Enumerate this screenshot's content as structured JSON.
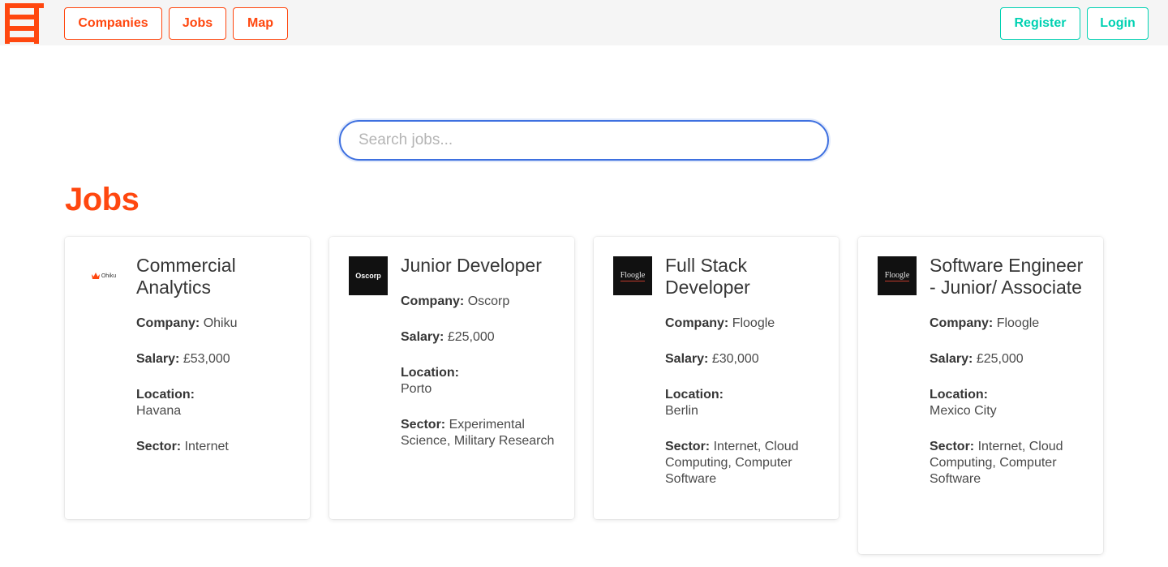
{
  "nav": {
    "links": [
      "Companies",
      "Jobs",
      "Map"
    ],
    "register": "Register",
    "login": "Login"
  },
  "search": {
    "placeholder": "Search jobs...",
    "value": ""
  },
  "page": {
    "title": "Jobs"
  },
  "colors": {
    "brand": "#ff470f",
    "accent": "#00d1b2",
    "focus": "#3e70e0"
  },
  "labels": {
    "company": "Company:",
    "salary": "Salary:",
    "location": "Location:",
    "sector": "Sector:"
  },
  "jobs": [
    {
      "title": "Commercial Analytics",
      "company": "Ohiku",
      "salary": "£53,000",
      "location": "Havana",
      "sector": "Internet",
      "logo_text": "Ohiku"
    },
    {
      "title": "Junior Developer",
      "company": "Oscorp",
      "salary": "£25,000",
      "location": "Porto",
      "sector": "Experimental Science, Military Research",
      "logo_text": "Oscorp"
    },
    {
      "title": "Full Stack Developer",
      "company": "Floogle",
      "salary": "£30,000",
      "location": "Berlin",
      "sector": "Internet, Cloud Computing, Computer Software",
      "logo_text": "Floogle"
    },
    {
      "title": "Software Engineer - Junior/ Associate",
      "company": "Floogle",
      "salary": "£25,000",
      "location": "Mexico City",
      "sector": "Internet, Cloud Computing, Computer Software",
      "logo_text": "Floogle"
    }
  ]
}
